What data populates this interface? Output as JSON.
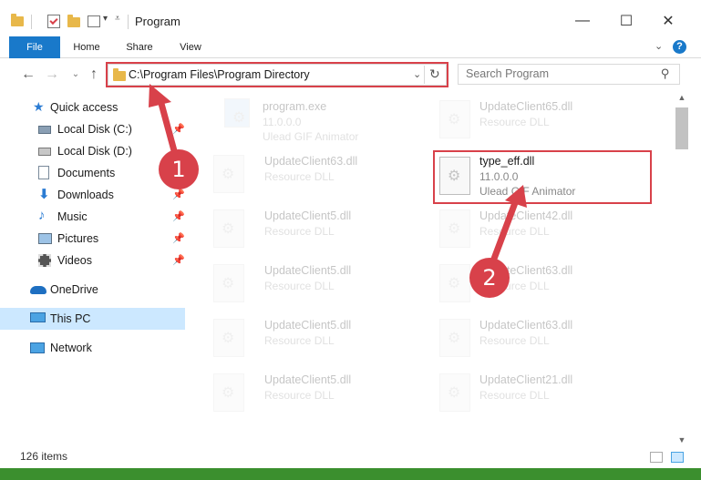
{
  "window": {
    "title": "Program"
  },
  "ribbon": {
    "tabs": [
      {
        "label": "File"
      },
      {
        "label": "Home"
      },
      {
        "label": "Share"
      },
      {
        "label": "View"
      }
    ]
  },
  "address": {
    "path": "C:\\Program Files\\Program Directory"
  },
  "search": {
    "placeholder": "Search Program"
  },
  "sidebar": {
    "items": [
      {
        "label": "Quick access",
        "icon": "star-icon"
      },
      {
        "label": "Local Disk (C:)",
        "icon": "drive-icon"
      },
      {
        "label": "Local Disk (D:)",
        "icon": "drive-icon"
      },
      {
        "label": "Documents",
        "icon": "document-icon"
      },
      {
        "label": "Downloads",
        "icon": "download-icon"
      },
      {
        "label": "Music",
        "icon": "music-icon"
      },
      {
        "label": "Pictures",
        "icon": "picture-icon"
      },
      {
        "label": "Videos",
        "icon": "video-icon"
      },
      {
        "label": "OneDrive",
        "icon": "cloud-icon"
      },
      {
        "label": "This PC",
        "icon": "computer-icon"
      },
      {
        "label": "Network",
        "icon": "network-icon"
      }
    ]
  },
  "files": {
    "left": [
      {
        "name": "program.exe",
        "line2": "11.0.0.0",
        "line3": "Ulead GIF Animator"
      },
      {
        "name": "UpdateClient63.dll",
        "line2": "Resource DLL"
      },
      {
        "name": "UpdateClient5.dll",
        "line2": "Resource DLL"
      },
      {
        "name": "UpdateClient5.dll",
        "line2": "Resource DLL"
      },
      {
        "name": "UpdateClient5.dll",
        "line2": "Resource DLL"
      },
      {
        "name": "UpdateClient5.dll",
        "line2": "Resource DLL"
      }
    ],
    "right": [
      {
        "name": "UpdateClient65.dll",
        "line2": "Resource DLL"
      },
      {
        "name": "type_eff.dll",
        "line2": "11.0.0.0",
        "line3": "Ulead GIF Animator"
      },
      {
        "name": "UpdateClient42.dll",
        "line2": "Resource DLL"
      },
      {
        "name": "UpdateClient63.dll",
        "line2": "Resource DLL"
      },
      {
        "name": "UpdateClient63.dll",
        "line2": "Resource DLL"
      },
      {
        "name": "UpdateClient21.dll",
        "line2": "Resource DLL"
      }
    ]
  },
  "status": {
    "items": "126 items"
  },
  "annotations": {
    "badge1": "1",
    "badge2": "2"
  },
  "colors": {
    "accent": "#1979ca",
    "highlight": "#d8414a",
    "selection": "#cce8ff"
  }
}
